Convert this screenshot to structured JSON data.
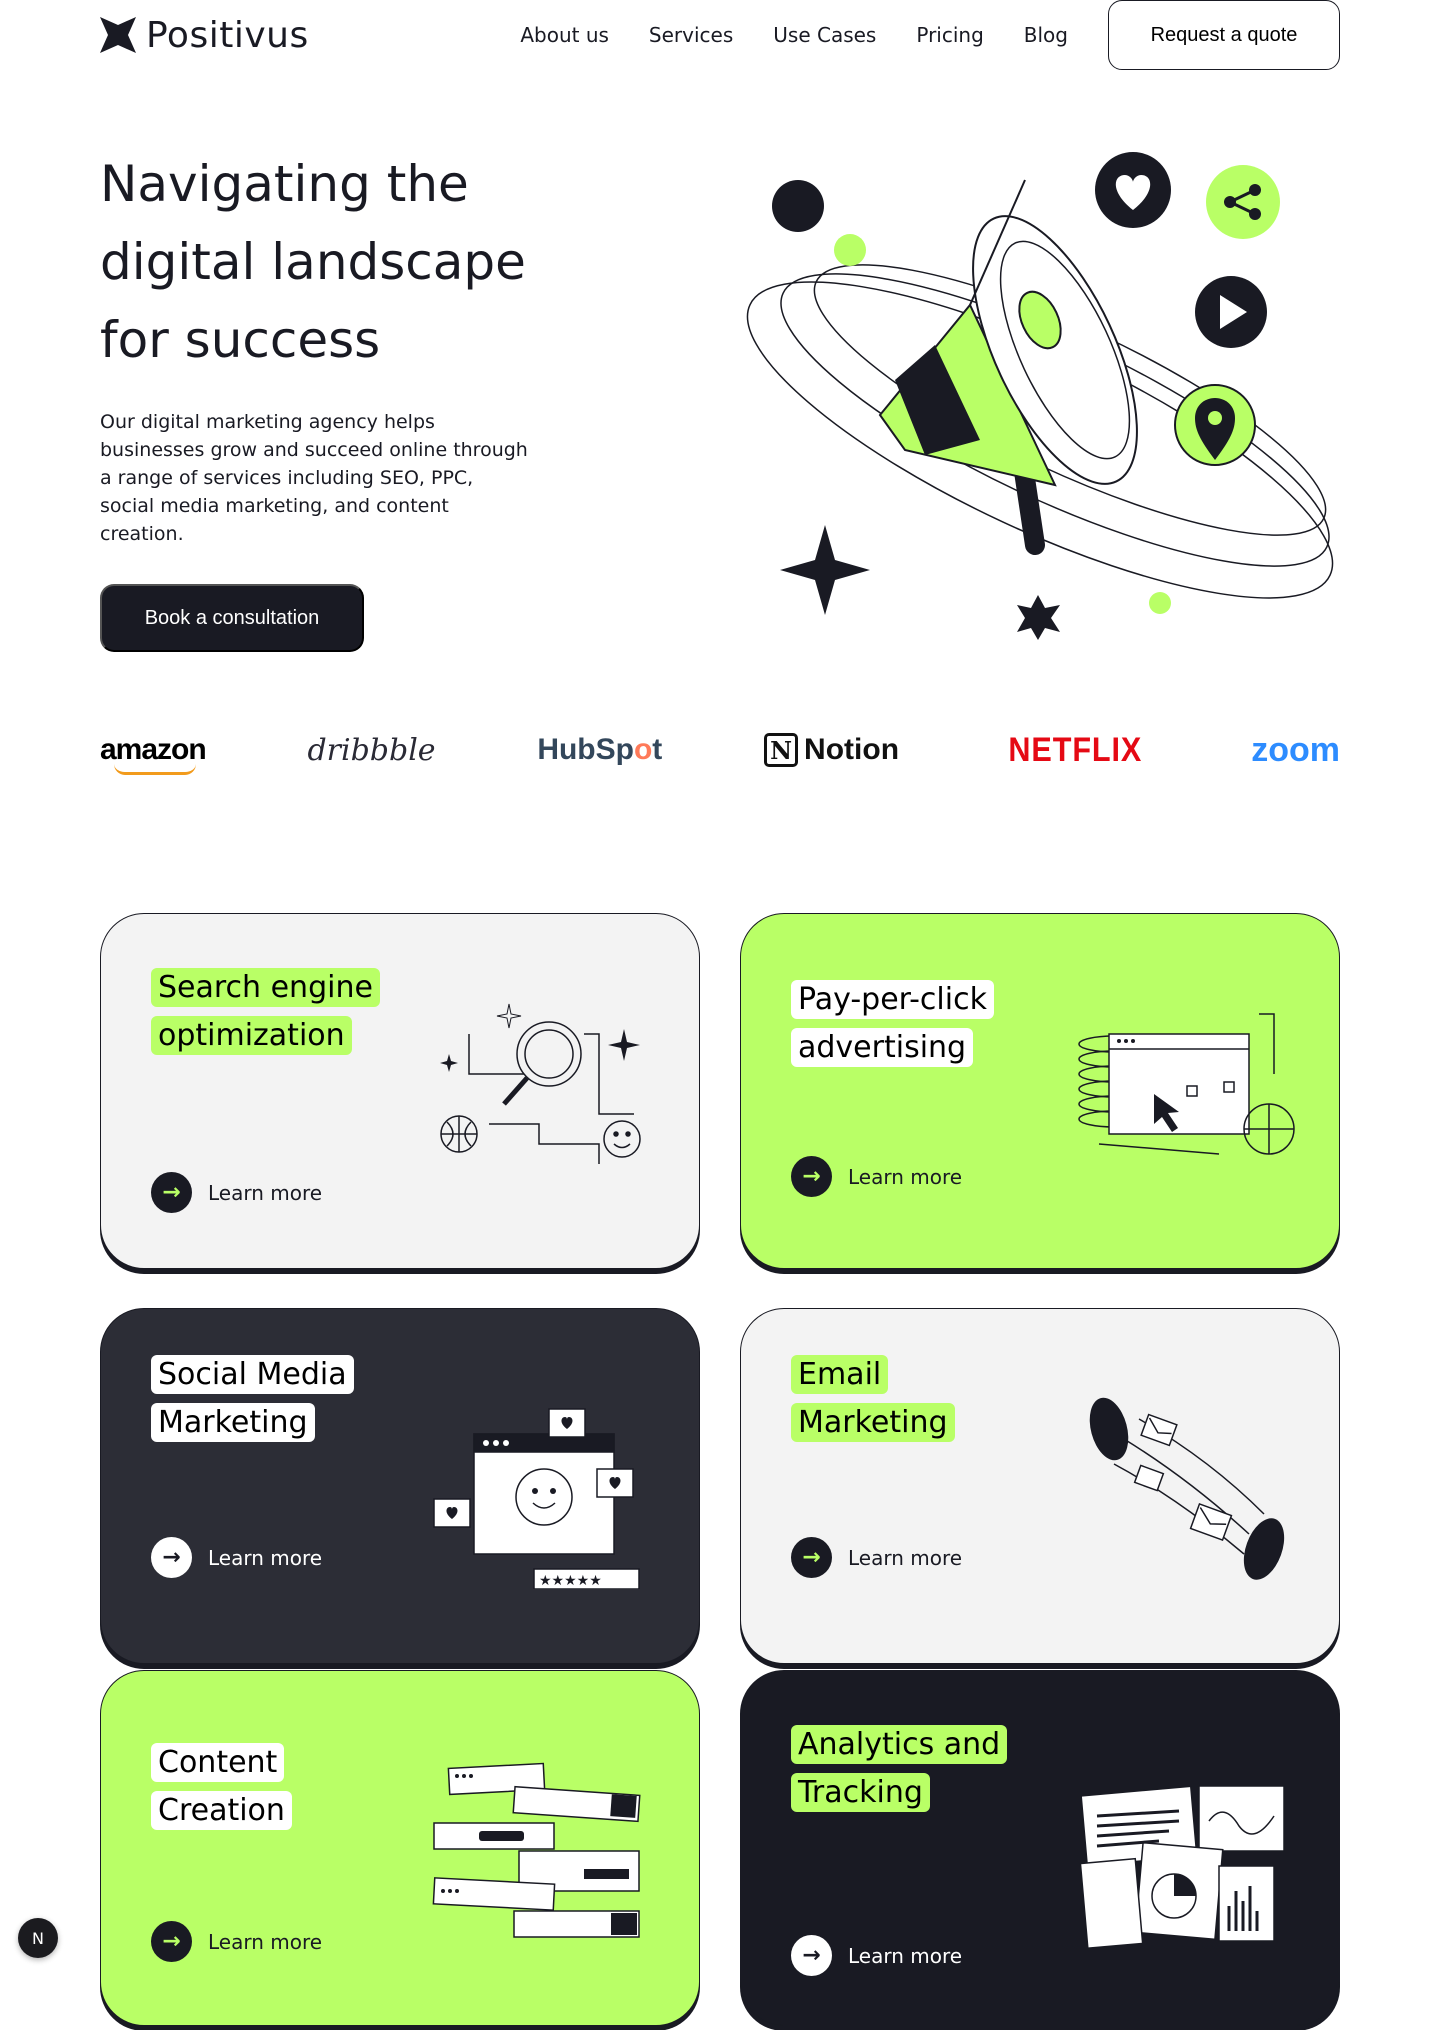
{
  "nav": {
    "logo_text": "Positivus",
    "links": [
      "About us",
      "Services",
      "Use Cases",
      "Pricing",
      "Blog"
    ],
    "cta": "Request a quote"
  },
  "hero": {
    "title": "Navigating the digital landscape for success",
    "description": "Our digital marketing agency helps businesses grow and succeed online through a range of services including SEO, PPC, social media marketing, and content creation.",
    "button": "Book a consultation"
  },
  "logos": {
    "amazon": "amazon",
    "dribbble": "dribbble",
    "hubspot_pre": "HubSp",
    "hubspot_o": "o",
    "hubspot_post": "t",
    "notion_mark": "N",
    "notion": "Notion",
    "netflix": "NETFLIX",
    "zoom": "zoom"
  },
  "services": [
    {
      "title_lines": [
        "Search engine",
        "optimization"
      ],
      "learn": "Learn more"
    },
    {
      "title_lines": [
        "Pay-per-click",
        "advertising"
      ],
      "learn": "Learn more"
    },
    {
      "title_lines": [
        "Social Media",
        "Marketing"
      ],
      "learn": "Learn more"
    },
    {
      "title_lines": [
        "Email",
        "Marketing"
      ],
      "learn": "Learn more"
    },
    {
      "title_lines": [
        "Content",
        "Creation"
      ],
      "learn": "Learn more"
    },
    {
      "title_lines": [
        "Analytics and",
        "Tracking"
      ],
      "learn": "Learn more"
    }
  ],
  "colors": {
    "accent": "#b9ff66",
    "dark": "#191a23",
    "grey": "#f3f3f3"
  },
  "badge": "N",
  "icons": [
    "logo-star-icon",
    "heart-icon",
    "share-icon",
    "play-icon",
    "location-pin-icon",
    "megaphone-icon",
    "arrow-right-icon"
  ]
}
